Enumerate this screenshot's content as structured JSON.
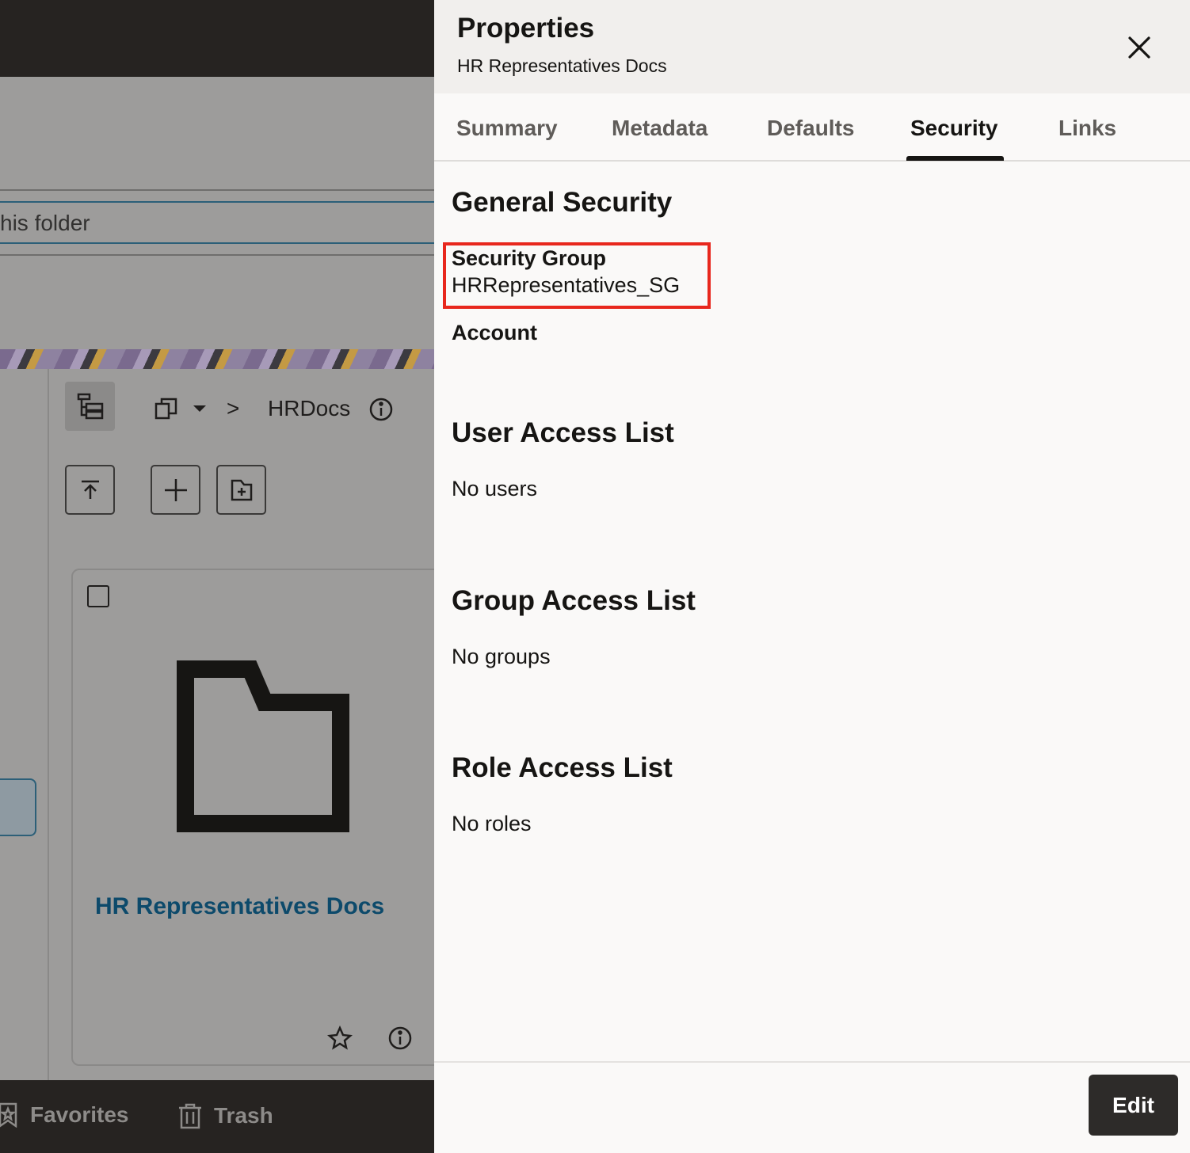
{
  "background": {
    "search_text": "his folder",
    "breadcrumb_current": "HRDocs",
    "breadcrumb_separator": ">",
    "card_title": "HR Representatives Docs",
    "bottom_nav": {
      "favorites": "Favorites",
      "trash": "Trash"
    }
  },
  "panel": {
    "title": "Properties",
    "subtitle": "HR Representatives Docs",
    "close_icon": "close-icon",
    "tabs": [
      {
        "label": "Summary"
      },
      {
        "label": "Metadata"
      },
      {
        "label": "Defaults"
      },
      {
        "label": "Security"
      },
      {
        "label": "Links"
      }
    ],
    "active_tab": "Security",
    "general_security": {
      "heading": "General Security",
      "security_group_label": "Security Group",
      "security_group_value": "HRRepresentatives_SG",
      "account_label": "Account"
    },
    "user_access": {
      "heading": "User Access List",
      "empty_text": "No users"
    },
    "group_access": {
      "heading": "Group Access List",
      "empty_text": "No groups"
    },
    "role_access": {
      "heading": "Role Access List",
      "empty_text": "No roles"
    },
    "edit_label": "Edit",
    "highlight_color": "#e8271d"
  }
}
